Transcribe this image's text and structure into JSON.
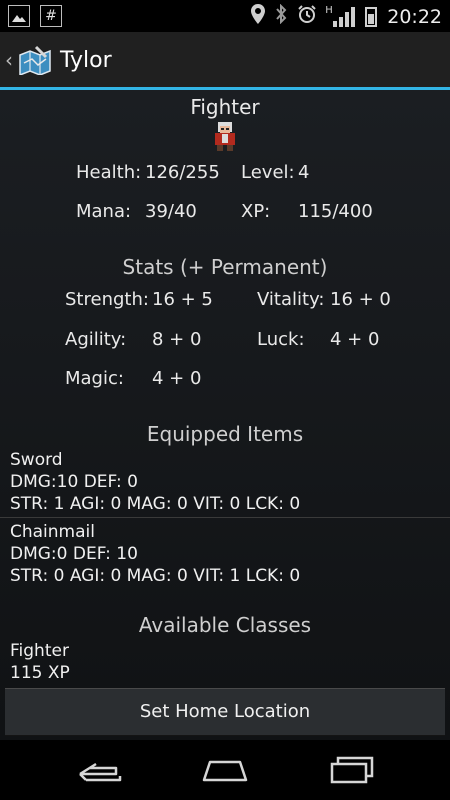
{
  "status_bar": {
    "time": "20:22",
    "network_label": "H"
  },
  "header": {
    "title": "Tylor"
  },
  "character": {
    "class_name": "Fighter",
    "health_label": "Health:",
    "health_value": "126/255",
    "level_label": "Level:",
    "level_value": "4",
    "mana_label": "Mana:",
    "mana_value": "39/40",
    "xp_label": "XP:",
    "xp_value": "115/400"
  },
  "stats": {
    "heading": "Stats (+ Permanent)",
    "strength_label": "Strength:",
    "strength_value": "16 + 5",
    "vitality_label": "Vitality:",
    "vitality_value": "16 + 0",
    "agility_label": "Agility:",
    "agility_value": "8 + 0",
    "luck_label": "Luck:",
    "luck_value": "4 + 0",
    "magic_label": "Magic:",
    "magic_value": "4 + 0"
  },
  "equipped": {
    "heading": "Equipped Items",
    "items": [
      {
        "name": "Sword",
        "combat": "DMG:10 DEF: 0",
        "attributes": "STR: 1 AGI: 0 MAG: 0 VIT: 0 LCK: 0"
      },
      {
        "name": "Chainmail",
        "combat": "DMG:0 DEF: 10",
        "attributes": "STR: 0 AGI: 0 MAG: 0 VIT: 1 LCK: 0"
      }
    ]
  },
  "classes": {
    "heading": "Available Classes",
    "items": [
      {
        "name": "Fighter",
        "xp": "115 XP"
      }
    ]
  },
  "home_button": {
    "label": "Set Home Location"
  },
  "theme": {
    "accent": "#33b5e5",
    "background": "#000000"
  }
}
